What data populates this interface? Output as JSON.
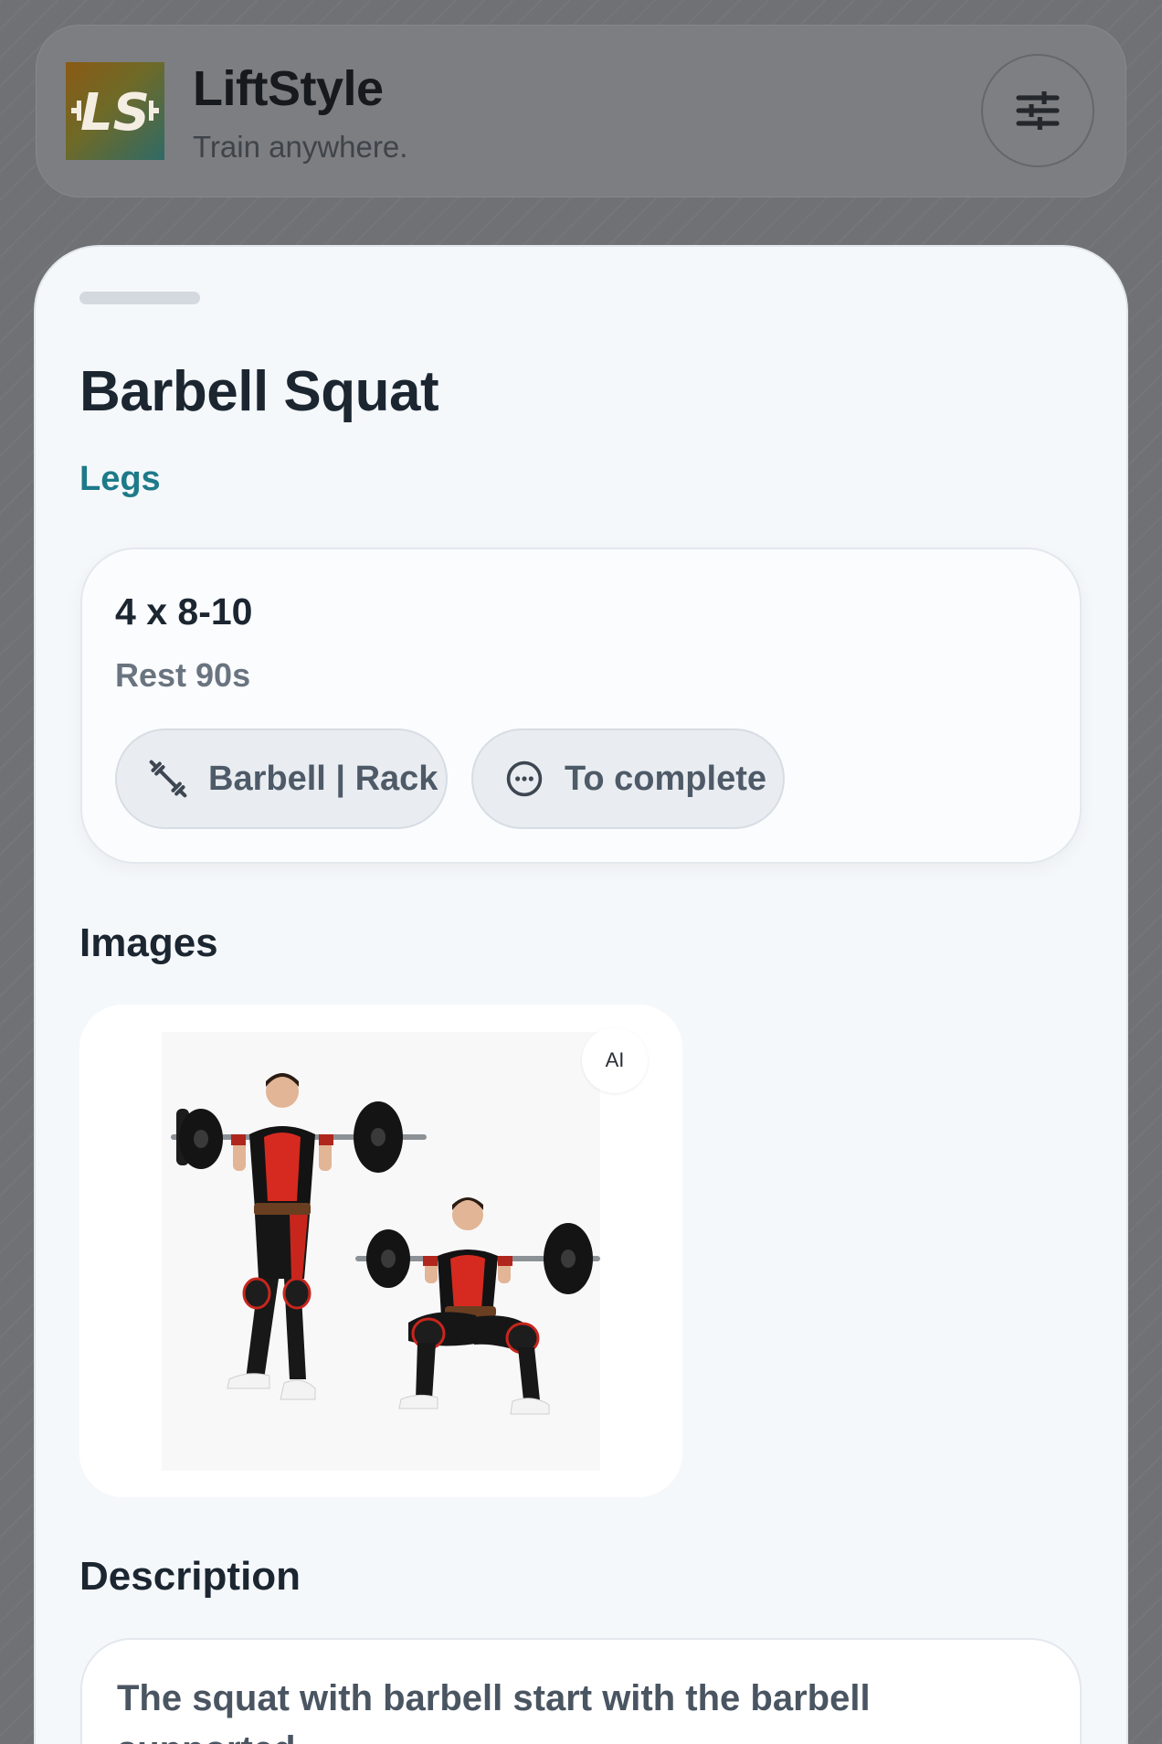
{
  "header": {
    "app_name": "LiftStyle",
    "tagline": "Train anywhere.",
    "logo_text": "LS",
    "filter_icon": "sliders-icon"
  },
  "exercise": {
    "title": "Barbell Squat",
    "muscle_group": "Legs",
    "sets_reps": "4 x 8-10",
    "rest": "Rest 90s",
    "equipment_chip": {
      "label": "Barbell | Rack",
      "icon": "dumbbell-icon"
    },
    "status_chip": {
      "label": "To complete",
      "icon": "more-circle-icon"
    }
  },
  "images_section": {
    "heading": "Images",
    "ai_badge": "AI"
  },
  "description_section": {
    "heading": "Description",
    "text": "The squat with barbell start with the barbell supported"
  },
  "colors": {
    "accent": "#1d7a89",
    "sheet_background": "#f5f8fb",
    "text_primary": "#1b2631",
    "text_secondary": "#6a7480"
  }
}
